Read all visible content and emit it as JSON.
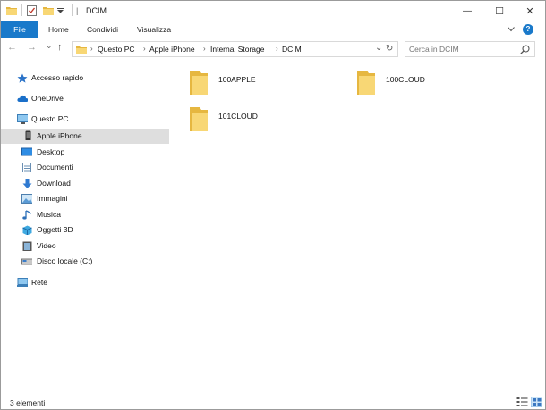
{
  "window": {
    "title": "DCIM",
    "controls": {
      "minimize": "—",
      "maximize": "☐",
      "close": "✕"
    }
  },
  "ribbon": {
    "tabs": [
      "File",
      "Home",
      "Condividi",
      "Visualizza"
    ],
    "help": "?"
  },
  "navigation": {
    "back": "←",
    "forward": "→",
    "recent": "⌄",
    "up": "↑"
  },
  "address": {
    "breadcrumbs": [
      "Questo PC",
      "Apple iPhone",
      "Internal Storage",
      "DCIM"
    ],
    "separator": "›",
    "dropdown": "⌄",
    "refresh": "↻"
  },
  "search": {
    "placeholder": "Cerca in DCIM"
  },
  "sidebar": {
    "items": [
      {
        "label": "Accesso rapido",
        "icon": "star-icon"
      },
      {
        "label": "OneDrive",
        "icon": "cloud-icon"
      },
      {
        "label": "Questo PC",
        "icon": "computer-icon"
      },
      {
        "label": "Apple iPhone",
        "icon": "phone-icon",
        "selected": true
      },
      {
        "label": "Desktop",
        "icon": "desktop-icon"
      },
      {
        "label": "Documenti",
        "icon": "documents-icon"
      },
      {
        "label": "Download",
        "icon": "download-icon"
      },
      {
        "label": "Immagini",
        "icon": "pictures-icon"
      },
      {
        "label": "Musica",
        "icon": "music-icon"
      },
      {
        "label": "Oggetti 3D",
        "icon": "objects-3d-icon"
      },
      {
        "label": "Video",
        "icon": "video-icon"
      },
      {
        "label": "Disco locale (C:)",
        "icon": "drive-icon"
      },
      {
        "label": "Rete",
        "icon": "network-icon"
      }
    ]
  },
  "folders": [
    {
      "name": "100APPLE"
    },
    {
      "name": "100CLOUD"
    },
    {
      "name": "101CLOUD"
    }
  ],
  "status": {
    "count": "3 elementi"
  },
  "colors": {
    "accent": "#1979ca",
    "folder": "#f8d775",
    "folder_dark": "#e6b740",
    "selection": "#dedede"
  }
}
